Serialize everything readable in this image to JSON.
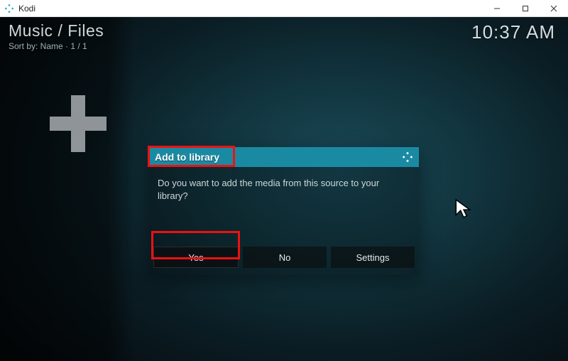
{
  "window": {
    "app_title": "Kodi"
  },
  "header": {
    "breadcrumb": "Music / Files",
    "sort_line": "Sort by: Name  ·  1 / 1",
    "clock": "10:37 AM"
  },
  "sidebar": {
    "add_tile_name": "add-source-tile"
  },
  "dialog": {
    "title": "Add to library",
    "message": "Do you want to add the media from this source to your library?",
    "buttons": {
      "yes": "Yes",
      "no": "No",
      "settings": "Settings"
    }
  }
}
